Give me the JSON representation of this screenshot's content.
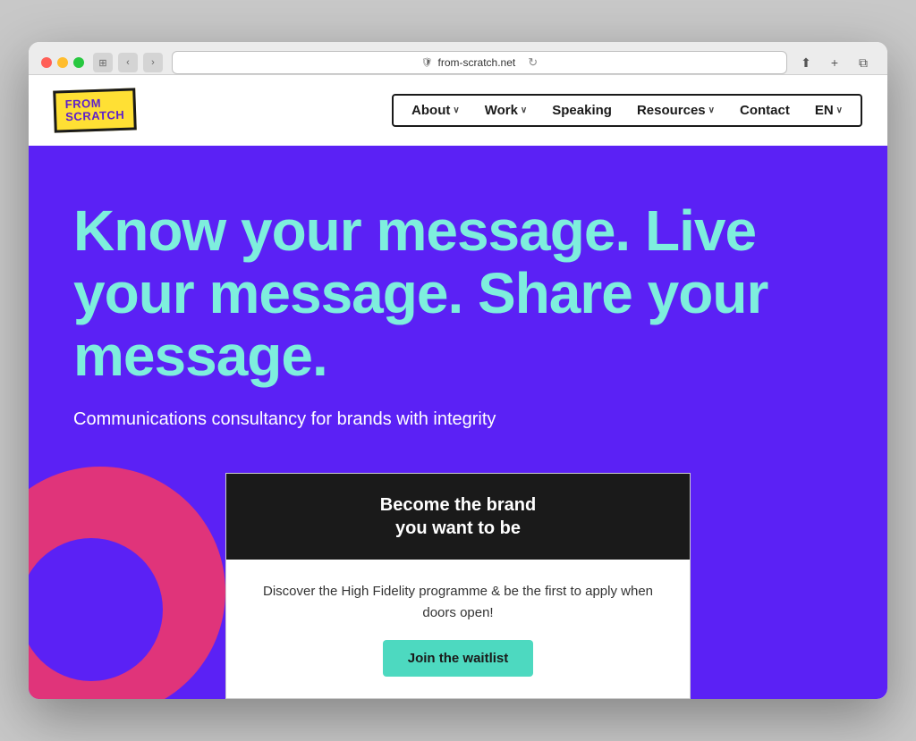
{
  "browser": {
    "url": "from-scratch.net",
    "url_label": "from-scratch.net",
    "reload_icon": "↻",
    "back_icon": "‹",
    "forward_icon": "›",
    "share_icon": "⬆",
    "add_tab_icon": "+",
    "tabs_icon": "⧉",
    "shield_icon": "🛡"
  },
  "logo": {
    "line1": "FROM",
    "line2": "SCRATCH"
  },
  "nav": {
    "items": [
      {
        "label": "About",
        "has_dropdown": true
      },
      {
        "label": "Work",
        "has_dropdown": true
      },
      {
        "label": "Speaking",
        "has_dropdown": false
      },
      {
        "label": "Resources",
        "has_dropdown": true
      },
      {
        "label": "Contact",
        "has_dropdown": false
      },
      {
        "label": "EN",
        "has_dropdown": true
      }
    ]
  },
  "hero": {
    "heading": "Know your message. Live your message. Share your message.",
    "subtext": "Communications consultancy for brands with integrity"
  },
  "cta_card": {
    "title": "Become the brand\nyou want to be",
    "description": "Discover the High Fidelity programme & be the first to apply when doors open!",
    "button_label": "Join the waitlist"
  },
  "colors": {
    "hero_bg": "#5b21f5",
    "hero_heading": "#7eeedd",
    "logo_bg": "#FFE034",
    "logo_text": "#5c1fcc",
    "cta_header_bg": "#1a1a1a",
    "cta_button_bg": "#4dd9c0",
    "circle_color": "#e0347a"
  }
}
